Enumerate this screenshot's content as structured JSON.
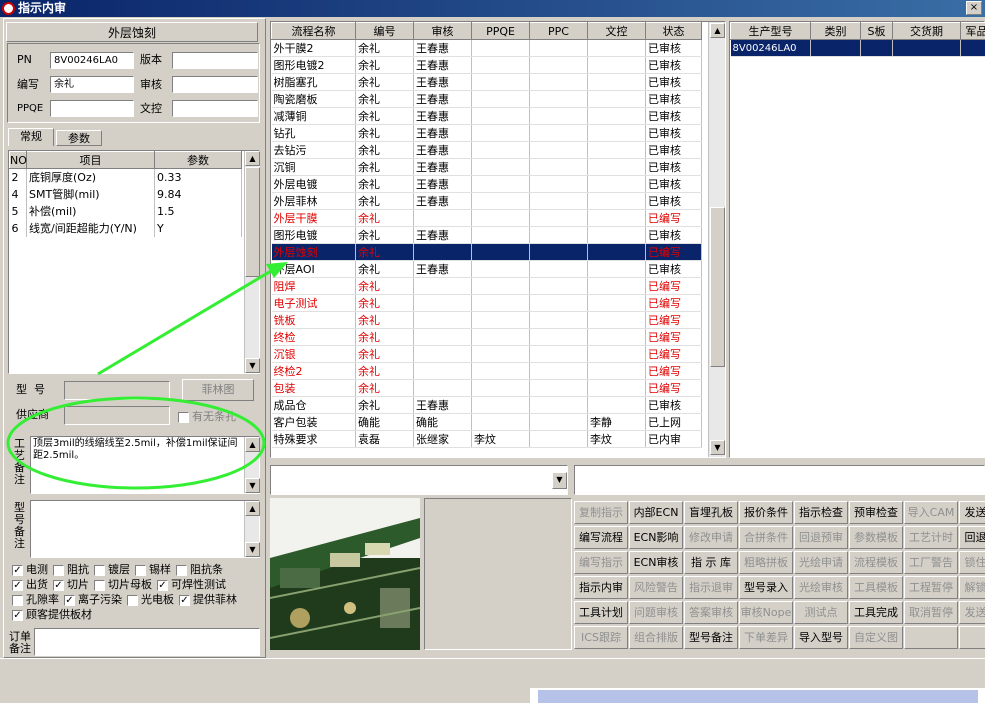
{
  "window": {
    "title": "指示内审",
    "close_glyph": "×"
  },
  "header": {
    "title": "外层蚀刻"
  },
  "form": {
    "pn_label": "PN",
    "pn_value": "8V00246LA0",
    "version_label": "版本",
    "version_value": "",
    "author_label": "编写",
    "author_value": "余礼",
    "review_label": "审核",
    "review_value": "",
    "ppqe_label": "PPQE",
    "ppqe_value": "",
    "doc_label": "文控",
    "doc_value": ""
  },
  "tabs": [
    {
      "label": "常规"
    },
    {
      "label": "参数"
    }
  ],
  "param_table": {
    "headers": [
      "NO",
      "项目",
      "参数"
    ],
    "rows": [
      {
        "no": "2",
        "item": "底铜厚度(Oz)",
        "value": "0.33"
      },
      {
        "no": "4",
        "item": "SMT管脚(mil)",
        "value": "9.84"
      },
      {
        "no": "5",
        "item": "补偿(mil)",
        "value": "1.5"
      },
      {
        "no": "6",
        "item": "线宽/间距超能力(Y/N)",
        "value": "Y"
      }
    ]
  },
  "model": {
    "label": "型  号",
    "value": "",
    "button": "菲林图"
  },
  "supplier": {
    "label": "供应商",
    "value": "",
    "check_label": "有无条孔"
  },
  "process_note": {
    "label": "工艺备注",
    "text": "顶层3mil的线缩线至2.5mil，补偿1mil保证间距2.5mil。"
  },
  "model_note": {
    "label": "型号备注",
    "text": ""
  },
  "checkboxes": [
    [
      {
        "label": "电测",
        "checked": true
      },
      {
        "label": "阻抗",
        "checked": false
      },
      {
        "label": "镀层",
        "checked": false
      },
      {
        "label": "锡样",
        "checked": false
      },
      {
        "label": "阻抗条",
        "checked": false
      }
    ],
    [
      {
        "label": "出货",
        "checked": true
      },
      {
        "label": "切片",
        "checked": true
      },
      {
        "label": "切片母板",
        "checked": false
      },
      {
        "label": "可焊性测试",
        "checked": true
      }
    ],
    [
      {
        "label": "孔隙率",
        "checked": false
      },
      {
        "label": "离子污染",
        "checked": true
      },
      {
        "label": "光电板",
        "checked": false
      },
      {
        "label": "提供菲林",
        "checked": true
      }
    ],
    [
      {
        "label": "顾客提供板材",
        "checked": true
      }
    ]
  ],
  "order_note": {
    "label": "订单备注"
  },
  "flow_table": {
    "headers": [
      "流程名称",
      "编号",
      "审核",
      "PPQE",
      "PPC",
      "文控",
      "状态"
    ],
    "rows": [
      {
        "name": "外干膜2",
        "code": "余礼",
        "review": "王春惠",
        "ppqe": "",
        "ppc": "",
        "doc": "",
        "status": "已审核",
        "style": ""
      },
      {
        "name": "图形电镀2",
        "code": "余礼",
        "review": "王春惠",
        "ppqe": "",
        "ppc": "",
        "doc": "",
        "status": "已审核",
        "style": ""
      },
      {
        "name": "树脂塞孔",
        "code": "余礼",
        "review": "王春惠",
        "ppqe": "",
        "ppc": "",
        "doc": "",
        "status": "已审核",
        "style": ""
      },
      {
        "name": "陶瓷磨板",
        "code": "余礼",
        "review": "王春惠",
        "ppqe": "",
        "ppc": "",
        "doc": "",
        "status": "已审核",
        "style": ""
      },
      {
        "name": "减薄铜",
        "code": "余礼",
        "review": "王春惠",
        "ppqe": "",
        "ppc": "",
        "doc": "",
        "status": "已审核",
        "style": ""
      },
      {
        "name": "钻孔",
        "code": "余礼",
        "review": "王春惠",
        "ppqe": "",
        "ppc": "",
        "doc": "",
        "status": "已审核",
        "style": ""
      },
      {
        "name": "去钻污",
        "code": "余礼",
        "review": "王春惠",
        "ppqe": "",
        "ppc": "",
        "doc": "",
        "status": "已审核",
        "style": ""
      },
      {
        "name": "沉铜",
        "code": "余礼",
        "review": "王春惠",
        "ppqe": "",
        "ppc": "",
        "doc": "",
        "status": "已审核",
        "style": ""
      },
      {
        "name": "外层电镀",
        "code": "余礼",
        "review": "王春惠",
        "ppqe": "",
        "ppc": "",
        "doc": "",
        "status": "已审核",
        "style": ""
      },
      {
        "name": "外层菲林",
        "code": "余礼",
        "review": "王春惠",
        "ppqe": "",
        "ppc": "",
        "doc": "",
        "status": "已审核",
        "style": ""
      },
      {
        "name": "外层干膜",
        "code": "余礼",
        "review": "",
        "ppqe": "",
        "ppc": "",
        "doc": "",
        "status": "已编写",
        "style": "red"
      },
      {
        "name": "图形电镀",
        "code": "余礼",
        "review": "王春惠",
        "ppqe": "",
        "ppc": "",
        "doc": "",
        "status": "已审核",
        "style": ""
      },
      {
        "name": "外层蚀刻",
        "code": "余礼",
        "review": "",
        "ppqe": "",
        "ppc": "",
        "doc": "",
        "status": "已编写",
        "style": "sel"
      },
      {
        "name": "外层AOI",
        "code": "余礼",
        "review": "王春惠",
        "ppqe": "",
        "ppc": "",
        "doc": "",
        "status": "已审核",
        "style": ""
      },
      {
        "name": "阻焊",
        "code": "余礼",
        "review": "",
        "ppqe": "",
        "ppc": "",
        "doc": "",
        "status": "已编写",
        "style": "red"
      },
      {
        "name": "电子测试",
        "code": "余礼",
        "review": "",
        "ppqe": "",
        "ppc": "",
        "doc": "",
        "status": "已编写",
        "style": "red"
      },
      {
        "name": "铣板",
        "code": "余礼",
        "review": "",
        "ppqe": "",
        "ppc": "",
        "doc": "",
        "status": "已编写",
        "style": "red"
      },
      {
        "name": "终检",
        "code": "余礼",
        "review": "",
        "ppqe": "",
        "ppc": "",
        "doc": "",
        "status": "已编写",
        "style": "red"
      },
      {
        "name": "沉银",
        "code": "余礼",
        "review": "",
        "ppqe": "",
        "ppc": "",
        "doc": "",
        "status": "已编写",
        "style": "red"
      },
      {
        "name": "终检2",
        "code": "余礼",
        "review": "",
        "ppqe": "",
        "ppc": "",
        "doc": "",
        "status": "已编写",
        "style": "red"
      },
      {
        "name": "包装",
        "code": "余礼",
        "review": "",
        "ppqe": "",
        "ppc": "",
        "doc": "",
        "status": "已编写",
        "style": "red"
      },
      {
        "name": "成品仓",
        "code": "余礼",
        "review": "王春惠",
        "ppqe": "",
        "ppc": "",
        "doc": "",
        "status": "已审核",
        "style": ""
      },
      {
        "name": "客户包装",
        "code": "确能",
        "review": "确能",
        "ppqe": "",
        "ppc": "",
        "doc": "李静",
        "status": "已上网",
        "style": ""
      },
      {
        "name": "特殊要求",
        "code": "袁磊",
        "review": "张继家",
        "ppqe": "李炆",
        "ppc": "",
        "doc": "李炆",
        "status": "已内审",
        "style": ""
      }
    ]
  },
  "prod_table": {
    "headers": [
      "生产型号",
      "类别",
      "S板",
      "交货期",
      "军品"
    ],
    "rows": [
      {
        "model": "8V00246LA0",
        "type": "",
        "s": "",
        "date": "",
        "mil": ""
      }
    ]
  },
  "buttons": [
    [
      {
        "label": "复制指示",
        "enabled": false
      },
      {
        "label": "内部ECN",
        "enabled": true
      },
      {
        "label": "盲埋孔板",
        "enabled": true
      },
      {
        "label": "报价条件",
        "enabled": true
      },
      {
        "label": "指示检查",
        "enabled": true
      },
      {
        "label": "预审检查",
        "enabled": true
      },
      {
        "label": "导入CAM",
        "enabled": false
      },
      {
        "label": "发送",
        "enabled": true
      }
    ],
    [
      {
        "label": "编写流程",
        "enabled": true
      },
      {
        "label": "ECN影响",
        "enabled": true
      },
      {
        "label": "修改申请",
        "enabled": false
      },
      {
        "label": "合拼条件",
        "enabled": false
      },
      {
        "label": "回退预审",
        "enabled": false
      },
      {
        "label": "参数模板",
        "enabled": false
      },
      {
        "label": "工艺计时",
        "enabled": false
      },
      {
        "label": "回退",
        "enabled": true
      }
    ],
    [
      {
        "label": "编写指示",
        "enabled": false
      },
      {
        "label": "ECN审核",
        "enabled": true
      },
      {
        "label": "指 示 库",
        "enabled": true
      },
      {
        "label": "粗略拼板",
        "enabled": false
      },
      {
        "label": "光绘申请",
        "enabled": false
      },
      {
        "label": "流程模板",
        "enabled": false
      },
      {
        "label": "工厂警告",
        "enabled": false
      },
      {
        "label": "锁住",
        "enabled": false
      }
    ],
    [
      {
        "label": "指示内审",
        "enabled": true
      },
      {
        "label": "风险警告",
        "enabled": false
      },
      {
        "label": "指示退审",
        "enabled": false
      },
      {
        "label": "型号录入",
        "enabled": true
      },
      {
        "label": "光绘审核",
        "enabled": false
      },
      {
        "label": "工具模板",
        "enabled": false
      },
      {
        "label": "工程暂停",
        "enabled": false
      },
      {
        "label": "解锁",
        "enabled": false
      }
    ],
    [
      {
        "label": "工具计划",
        "enabled": true
      },
      {
        "label": "问题审核",
        "enabled": false
      },
      {
        "label": "答案审核",
        "enabled": false
      },
      {
        "label": "审核Nope",
        "enabled": false
      },
      {
        "label": "测试点",
        "enabled": false
      },
      {
        "label": "工具完成",
        "enabled": true
      },
      {
        "label": "取消暂停",
        "enabled": false
      },
      {
        "label": "发送",
        "enabled": false
      }
    ],
    [
      {
        "label": "ICS跟踪",
        "enabled": false
      },
      {
        "label": "组合排版",
        "enabled": false
      },
      {
        "label": "型号备注",
        "enabled": true
      },
      {
        "label": "下单差异",
        "enabled": false
      },
      {
        "label": "导入型号",
        "enabled": true
      },
      {
        "label": "自定义图",
        "enabled": false
      },
      {
        "label": "",
        "enabled": false
      },
      {
        "label": "",
        "enabled": false
      }
    ]
  ],
  "icons": {
    "annotation": "green-circle-arrow-annotation",
    "photo": "pcb-board-photo"
  },
  "colors": {
    "title_start": "#0a246a",
    "title_end": "#3a6ea5",
    "selected_row": "#0a246a",
    "red_text": "#e00000",
    "annotation": "#33ee33"
  }
}
